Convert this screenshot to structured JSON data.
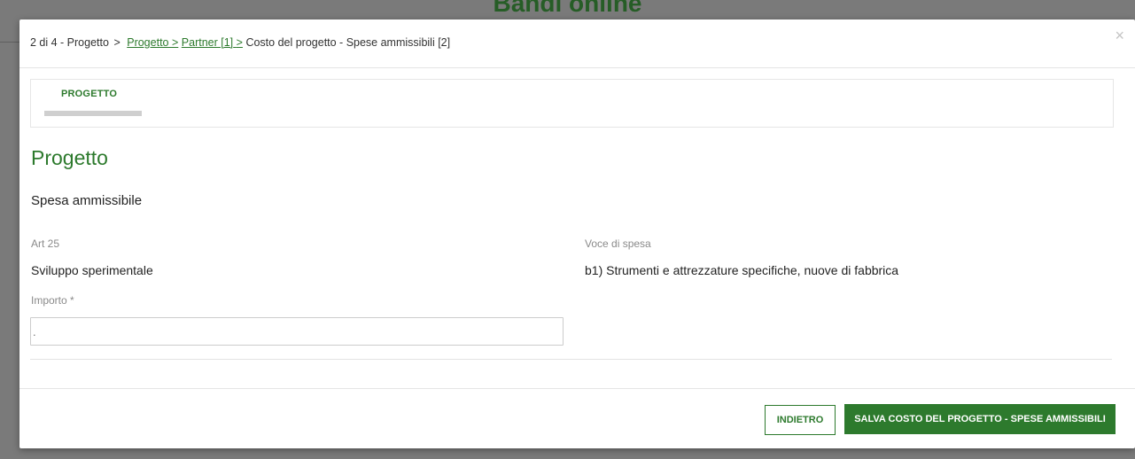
{
  "backdrop": {
    "title": "Bandi online"
  },
  "modal": {
    "breadcrumb": {
      "step": "2 di 4 - Progetto",
      "links": [
        "Progetto",
        "Partner [1]"
      ],
      "current": "Costo del progetto - Spese ammissibili [2]",
      "separator": ">"
    },
    "close_symbol": "×",
    "tabs": [
      {
        "label": "PROGETTO"
      }
    ],
    "section_title": "Progetto",
    "subsection_title": "Spesa ammissibile",
    "fields": {
      "art": {
        "label": "Art 25",
        "value": "Sviluppo sperimentale"
      },
      "voce": {
        "label": "Voce di spesa",
        "value": "b1) Strumenti e attrezzature specifiche, nuove di fabbrica"
      },
      "importo": {
        "label": "Importo *",
        "value": "",
        "placeholder": "."
      }
    },
    "footer": {
      "back_label": "INDIETRO",
      "save_label": "SALVA COSTO DEL PROGETTO - SPESE AMMISSIBILI"
    }
  },
  "colors": {
    "accent": "#2d7a2d",
    "overlay": "#7a7a7a",
    "label_gray": "#8a8a8a"
  }
}
